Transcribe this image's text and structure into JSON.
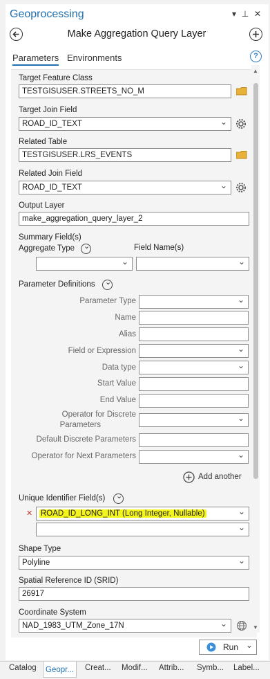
{
  "window": {
    "title": "Geoprocessing",
    "menu_glyph": "▾",
    "pin_glyph": "⊥",
    "close_glyph": "✕"
  },
  "tool": {
    "title": "Make Aggregation Query Layer"
  },
  "tabs": {
    "parameters": "Parameters",
    "environments": "Environments"
  },
  "help_glyph": "?",
  "params": {
    "target_fc_label": "Target Feature Class",
    "target_fc_value": "TESTGISUSER.STREETS_NO_M",
    "target_join_label": "Target Join Field",
    "target_join_value": "ROAD_ID_TEXT",
    "related_table_label": "Related Table",
    "related_table_value": "TESTGISUSER.LRS_EVENTS",
    "related_join_label": "Related Join Field",
    "related_join_value": "ROAD_ID_TEXT",
    "output_layer_label": "Output Layer",
    "output_layer_value": "make_aggregation_query_layer_2",
    "summary_label": "Summary Field(s)",
    "aggregate_type_label": "Aggregate Type",
    "field_names_label": "Field Name(s)",
    "param_defs_label": "Parameter Definitions",
    "param_type_label": "Parameter Type",
    "name_label": "Name",
    "alias_label": "Alias",
    "field_expr_label": "Field or Expression",
    "data_type_label": "Data type",
    "start_value_label": "Start Value",
    "end_value_label": "End Value",
    "op_discrete_label_1": "Operator for Discrete",
    "op_discrete_label_2": "Parameters",
    "default_discrete_label": "Default Discrete Parameters",
    "op_next_label": "Operator for Next Parameters",
    "add_another_label": "Add another",
    "unique_id_label": "Unique Identifier Field(s)",
    "unique_id_value": "ROAD_ID_LONG_INT (Long Integer, Nullable)",
    "shape_type_label": "Shape Type",
    "shape_type_value": "Polyline",
    "srid_label": "Spatial Reference ID (SRID)",
    "srid_value": "26917",
    "coord_sys_label": "Coordinate System",
    "coord_sys_value": "NAD_1983_UTM_Zone_17N"
  },
  "run_label": "Run",
  "bottom_tabs": [
    "Catalog",
    "Geopr...",
    "Creat...",
    "Modif...",
    "Attrib...",
    "Symb...",
    "Label..."
  ],
  "colors": {
    "accent": "#1f6fb2",
    "highlight": "#f5f51e",
    "folder": "#e8b23a"
  }
}
